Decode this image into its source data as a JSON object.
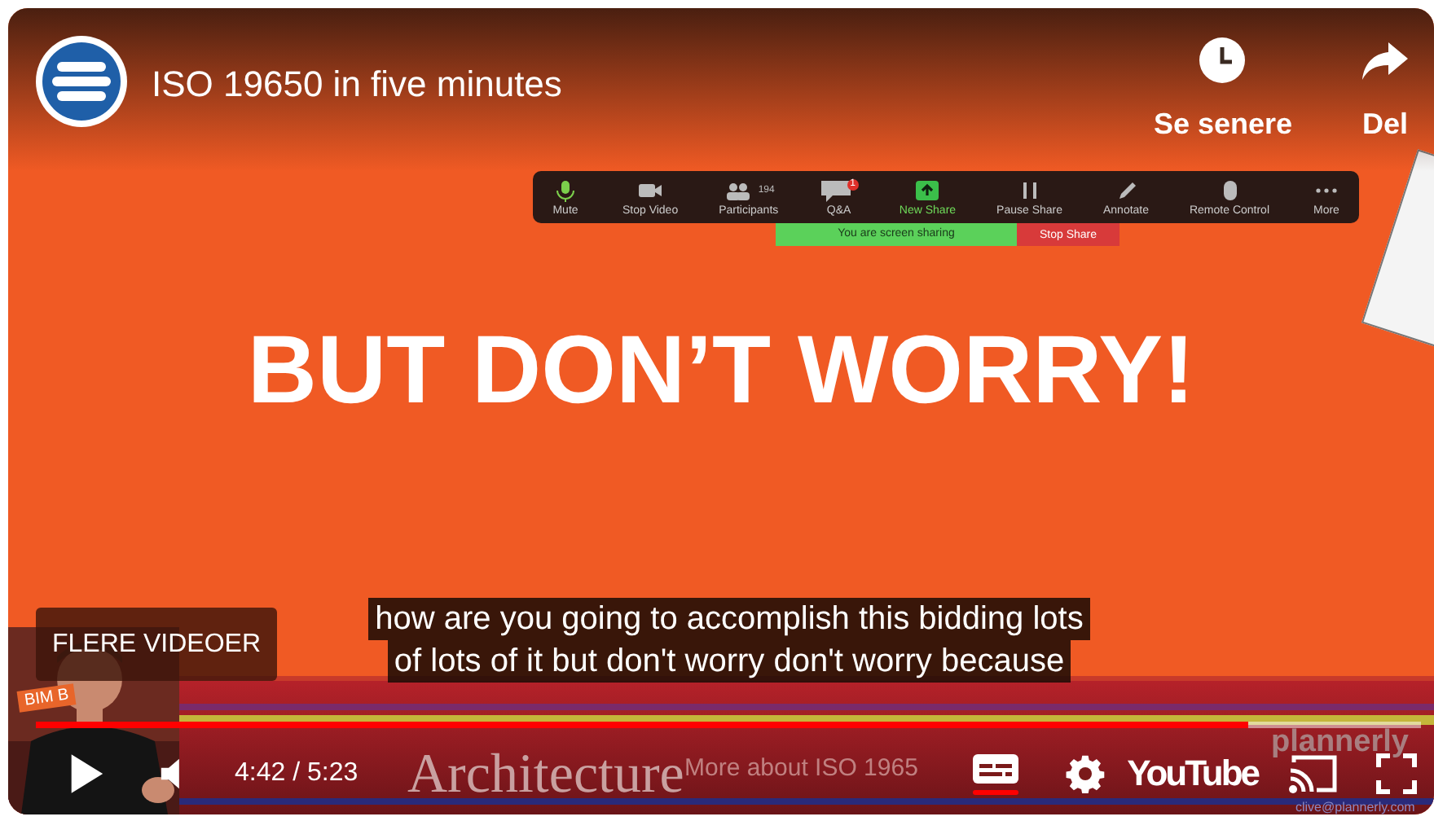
{
  "player": {
    "title": "ISO 19650 in five minutes",
    "actions": [
      {
        "kind": "clock",
        "label": "Se senere"
      },
      {
        "kind": "share",
        "label": "Del"
      }
    ]
  },
  "zoom_toolbar": {
    "items": [
      {
        "kind": "mic",
        "label": "Mute"
      },
      {
        "kind": "video",
        "label": "Stop Video"
      },
      {
        "kind": "participants",
        "label": "Participants",
        "count": "194"
      },
      {
        "kind": "qa",
        "label": "Q&A",
        "badge": "1"
      },
      {
        "kind": "new-share",
        "label": "New Share"
      },
      {
        "kind": "pause",
        "label": "Pause Share"
      },
      {
        "kind": "pencil",
        "label": "Annotate"
      },
      {
        "kind": "mouse",
        "label": "Remote Control"
      },
      {
        "kind": "dots",
        "label": "More"
      }
    ],
    "sharing_status": "You are screen sharing",
    "stop_share": "Stop Share"
  },
  "slide": {
    "heading": "BUT DON’T WORRY!"
  },
  "more_videos": "FLERE VIDEOER",
  "captions": [
    "how are you going to accomplish this bidding lots",
    "of lots of it but don't worry don't worry because"
  ],
  "banner": {
    "tag": "BIM B",
    "school": "Architecture",
    "promo": "More about ISO 1965",
    "logo": "plannerly",
    "email": "clive@plannerly.com"
  },
  "controls": {
    "progress": {
      "level": 0.875
    },
    "time": "4:42 / 5:23",
    "captions_on": true,
    "brand": "YouTube"
  }
}
